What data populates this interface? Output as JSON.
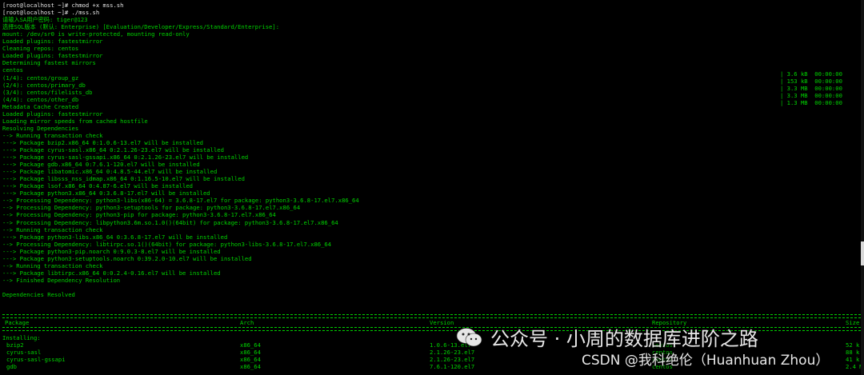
{
  "terminal": {
    "lines": [
      "[root@localhost ~]# chmod +x mss.sh",
      "[root@localhost ~]# ./mss.sh",
      "请输入SA用户密码: tiger@123",
      "选择SQL版本 (默认: Enterprise) [Evaluation/Developer/Express/Standard/Enterprise]:",
      "mount: /dev/sr0 is write-protected, mounting read-only",
      "Loaded plugins: fastestmirror",
      "Cleaning repos: centos",
      "Loaded plugins: fastestmirror",
      "Determining fastest mirrors",
      "centos",
      "(1/4): centos/group_gz",
      "(2/4): centos/primary_db",
      "(3/4): centos/filelists_db",
      "(4/4): centos/other_db",
      "Metadata Cache Created",
      "Loaded plugins: fastestmirror",
      "Loading mirror speeds from cached hostfile",
      "Resolving Dependencies",
      "--> Running transaction check",
      "---> Package bzip2.x86_64 0:1.0.6-13.el7 will be installed",
      "---> Package cyrus-sasl.x86_64 0:2.1.26-23.el7 will be installed",
      "---> Package cyrus-sasl-gssapi.x86_64 0:2.1.26-23.el7 will be installed",
      "---> Package gdb.x86_64 0:7.6.1-120.el7 will be installed",
      "---> Package libatomic.x86_64 0:4.8.5-44.el7 will be installed",
      "---> Package libsss_nss_idmap.x86_64 0:1.16.5-10.el7 will be installed",
      "---> Package lsof.x86_64 0:4.87-6.el7 will be installed",
      "---> Package python3.x86_64 0:3.6.8-17.el7 will be installed",
      "--> Processing Dependency: python3-libs(x86-64) = 3.6.8-17.el7 for package: python3-3.6.8-17.el7.x86_64",
      "--> Processing Dependency: python3-setuptools for package: python3-3.6.8-17.el7.x86_64",
      "--> Processing Dependency: python3-pip for package: python3-3.6.8-17.el7.x86_64",
      "--> Processing Dependency: libpython3.6m.so.1.0()(64bit) for package: python3-3.6.8-17.el7.x86_64",
      "--> Running transaction check",
      "---> Package python3-libs.x86_64 0:3.6.8-17.el7 will be installed",
      "--> Processing Dependency: libtirpc.so.1()(64bit) for package: python3-libs-3.6.8-17.el7.x86_64",
      "---> Package python3-pip.noarch 0:9.0.3-8.el7 will be installed",
      "---> Package python3-setuptools.noarch 0:39.2.0-10.el7 will be installed",
      "--> Running transaction check",
      "---> Package libtirpc.x86_64 0:0.2.4-0.16.el7 will be installed",
      "--> Finished Dependency Resolution",
      "",
      "Dependencies Resolved"
    ],
    "right_column": [
      "| 3.6 kB  00:00:00",
      "| 153 kB  00:00:00",
      "| 3.3 MB  00:00:00",
      "| 3.3 MB  00:00:00",
      "| 1.3 MB  00:00:00"
    ],
    "table_headers": [
      "Package",
      "Arch",
      "Version",
      "Repository",
      "Size"
    ],
    "installing_label": "Installing:",
    "rows": [
      [
        "bzip2",
        "x86_64",
        "1.0.6-13.el7",
        "centos",
        "52 k"
      ],
      [
        "cyrus-sasl",
        "x86_64",
        "2.1.26-23.el7",
        "centos",
        "88 k"
      ],
      [
        "cyrus-sasl-gssapi",
        "x86_64",
        "2.1.26-23.el7",
        "centos",
        "41 k"
      ],
      [
        "gdb",
        "x86_64",
        "7.6.1-120.el7",
        "centos",
        "2.4 M"
      ]
    ]
  },
  "watermark": {
    "wechat": "公众号 · 小周的数据库进阶之路",
    "csdn": "CSDN @我科绝伦（Huanhuan Zhou）"
  },
  "colors": {
    "background": "#000000",
    "text_green": "#00d200",
    "text_white": "#e6e6e6"
  }
}
